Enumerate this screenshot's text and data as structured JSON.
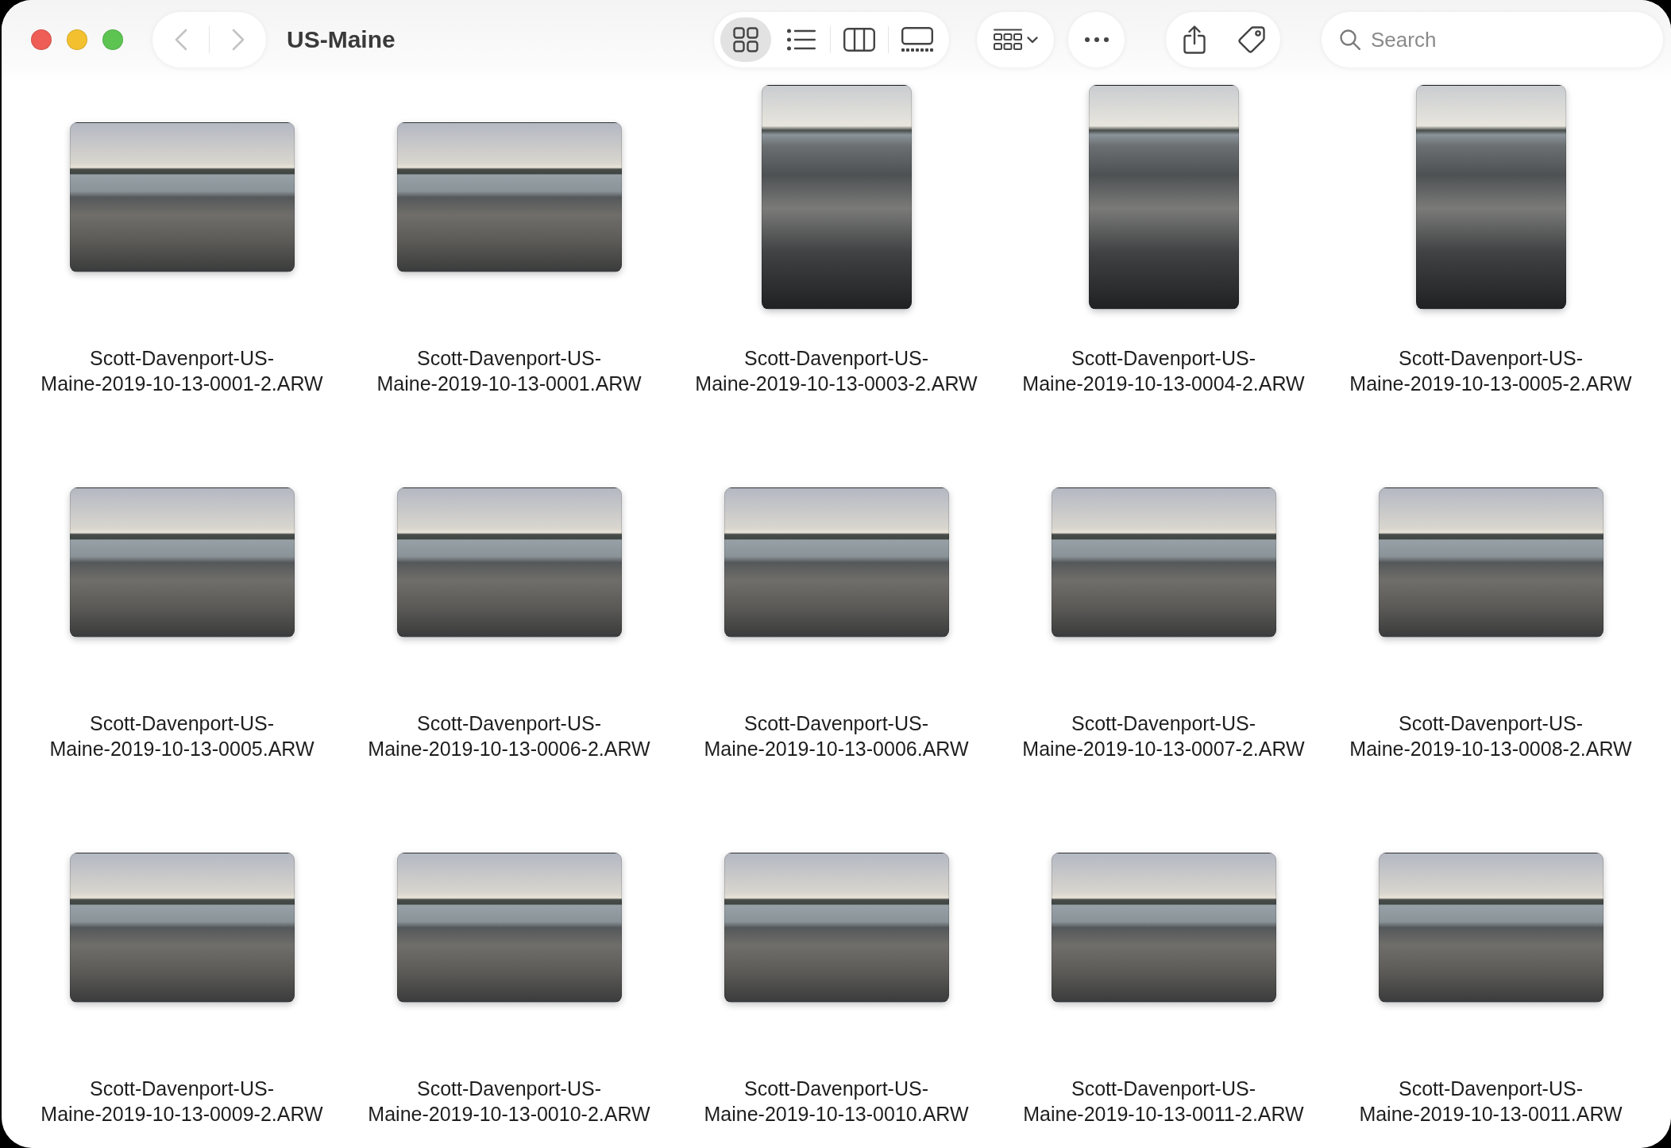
{
  "window": {
    "title": "US-Maine"
  },
  "navigation": [
    {
      "kind": "back",
      "disabled": true
    },
    {
      "kind": "forward",
      "disabled": true
    }
  ],
  "toolbar": {
    "view_modes": [
      {
        "kind": "icons",
        "selected": true
      },
      {
        "kind": "list",
        "selected": false
      },
      {
        "kind": "columns",
        "selected": false
      },
      {
        "kind": "gallery",
        "selected": false
      }
    ],
    "action_groups": [
      [
        {
          "kind": "group"
        }
      ],
      [
        {
          "kind": "more"
        }
      ],
      [
        {
          "kind": "share"
        },
        {
          "kind": "tags"
        }
      ]
    ]
  },
  "search": {
    "placeholder": "Search"
  },
  "files": [
    {
      "kind": "landscape",
      "name_lines": [
        "Scott-Davenport-US-",
        "Maine-2019-10-13-0001-2.ARW"
      ]
    },
    {
      "kind": "landscape",
      "name_lines": [
        "Scott-Davenport-US-",
        "Maine-2019-10-13-0001.ARW"
      ]
    },
    {
      "kind": "portrait",
      "name_lines": [
        "Scott-Davenport-US-",
        "Maine-2019-10-13-0003-2.ARW"
      ]
    },
    {
      "kind": "portrait",
      "name_lines": [
        "Scott-Davenport-US-",
        "Maine-2019-10-13-0004-2.ARW"
      ]
    },
    {
      "kind": "portrait",
      "name_lines": [
        "Scott-Davenport-US-",
        "Maine-2019-10-13-0005-2.ARW"
      ]
    },
    {
      "kind": "landscape",
      "name_lines": [
        "Scott-Davenport-US-",
        "Maine-2019-10-13-0005.ARW"
      ]
    },
    {
      "kind": "landscape",
      "name_lines": [
        "Scott-Davenport-US-",
        "Maine-2019-10-13-0006-2.ARW"
      ]
    },
    {
      "kind": "landscape",
      "name_lines": [
        "Scott-Davenport-US-",
        "Maine-2019-10-13-0006.ARW"
      ]
    },
    {
      "kind": "landscape",
      "name_lines": [
        "Scott-Davenport-US-",
        "Maine-2019-10-13-0007-2.ARW"
      ]
    },
    {
      "kind": "landscape",
      "name_lines": [
        "Scott-Davenport-US-",
        "Maine-2019-10-13-0008-2.ARW"
      ]
    },
    {
      "kind": "landscape",
      "name_lines": [
        "Scott-Davenport-US-",
        "Maine-2019-10-13-0009-2.ARW"
      ]
    },
    {
      "kind": "landscape",
      "name_lines": [
        "Scott-Davenport-US-",
        "Maine-2019-10-13-0010-2.ARW"
      ]
    },
    {
      "kind": "landscape",
      "name_lines": [
        "Scott-Davenport-US-",
        "Maine-2019-10-13-0010.ARW"
      ]
    },
    {
      "kind": "landscape",
      "name_lines": [
        "Scott-Davenport-US-",
        "Maine-2019-10-13-0011-2.ARW"
      ]
    },
    {
      "kind": "landscape",
      "name_lines": [
        "Scott-Davenport-US-",
        "Maine-2019-10-13-0011.ARW"
      ]
    }
  ]
}
